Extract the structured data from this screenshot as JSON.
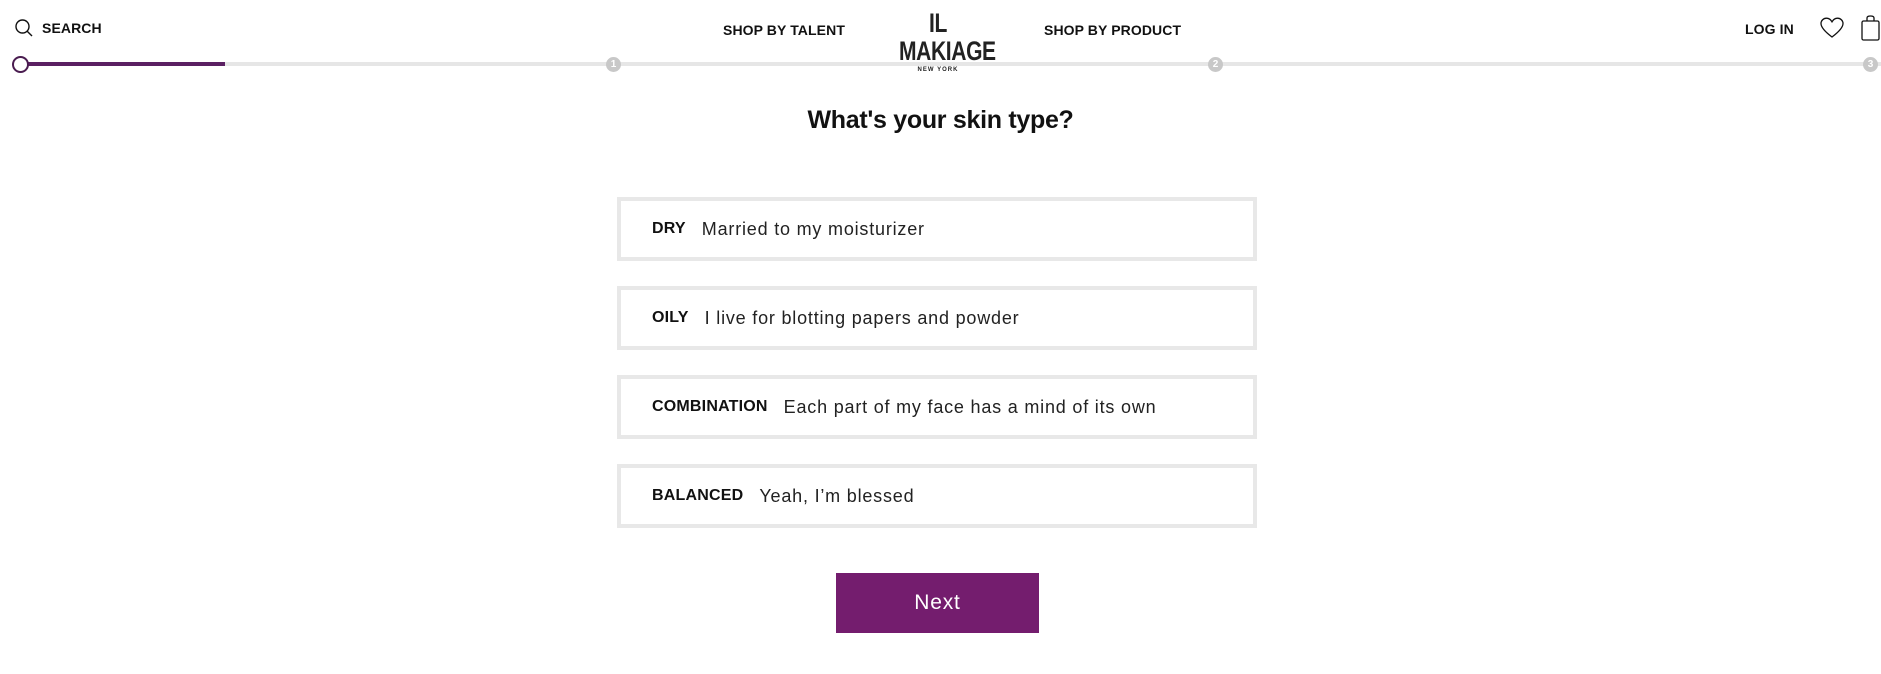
{
  "header": {
    "search_label": "SEARCH",
    "nav_talent": "SHOP BY TALENT",
    "nav_product": "SHOP BY PRODUCT",
    "logo_main": "IL MAKIAGE",
    "logo_sub": "NEW YORK",
    "login_label": "LOG IN",
    "icons": [
      "search-icon",
      "heart-icon",
      "shopping-bag-icon"
    ]
  },
  "progress": {
    "fraction_complete": 0.11,
    "steps": [
      "1",
      "2",
      "3"
    ],
    "accent_color": "#5b2062"
  },
  "quiz": {
    "question": "What's your skin type?",
    "options": [
      {
        "type": "DRY",
        "description": "Married to my moisturizer"
      },
      {
        "type": "OILY",
        "description": "I live for blotting papers and powder"
      },
      {
        "type": "COMBINATION",
        "description": "Each part of my face has a mind of its own"
      },
      {
        "type": "BALANCED",
        "description": "Yeah, I’m blessed"
      }
    ],
    "next_label": "Next",
    "button_color": "#741d6e"
  }
}
